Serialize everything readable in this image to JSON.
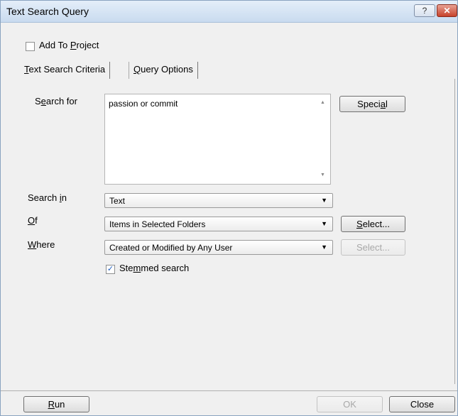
{
  "window": {
    "title": "Text Search Query",
    "help_label": "?",
    "close_label": "✕"
  },
  "add_to_project": {
    "label": "Add To Project",
    "checked": false
  },
  "tabs": [
    {
      "label": "Text Search Criteria",
      "active": true
    },
    {
      "label": "Query Options",
      "active": false
    }
  ],
  "criteria": {
    "search_for_label": "Search for",
    "search_for_value": "passion or commit",
    "special_button": "Special",
    "search_in_label": "Search in",
    "search_in_value": "Text",
    "of_label": "Of",
    "of_value": "Items in Selected Folders",
    "of_select_button": "Select...",
    "where_label": "Where",
    "where_value": "Created or Modified by Any User",
    "where_select_button": "Select...",
    "stemmed_label": "Stemmed search",
    "stemmed_checked": true
  },
  "footer": {
    "run_button": "Run",
    "ok_button": "OK",
    "close_button": "Close"
  },
  "icons": {
    "dropdown_arrow": "▼",
    "check": "✓"
  }
}
